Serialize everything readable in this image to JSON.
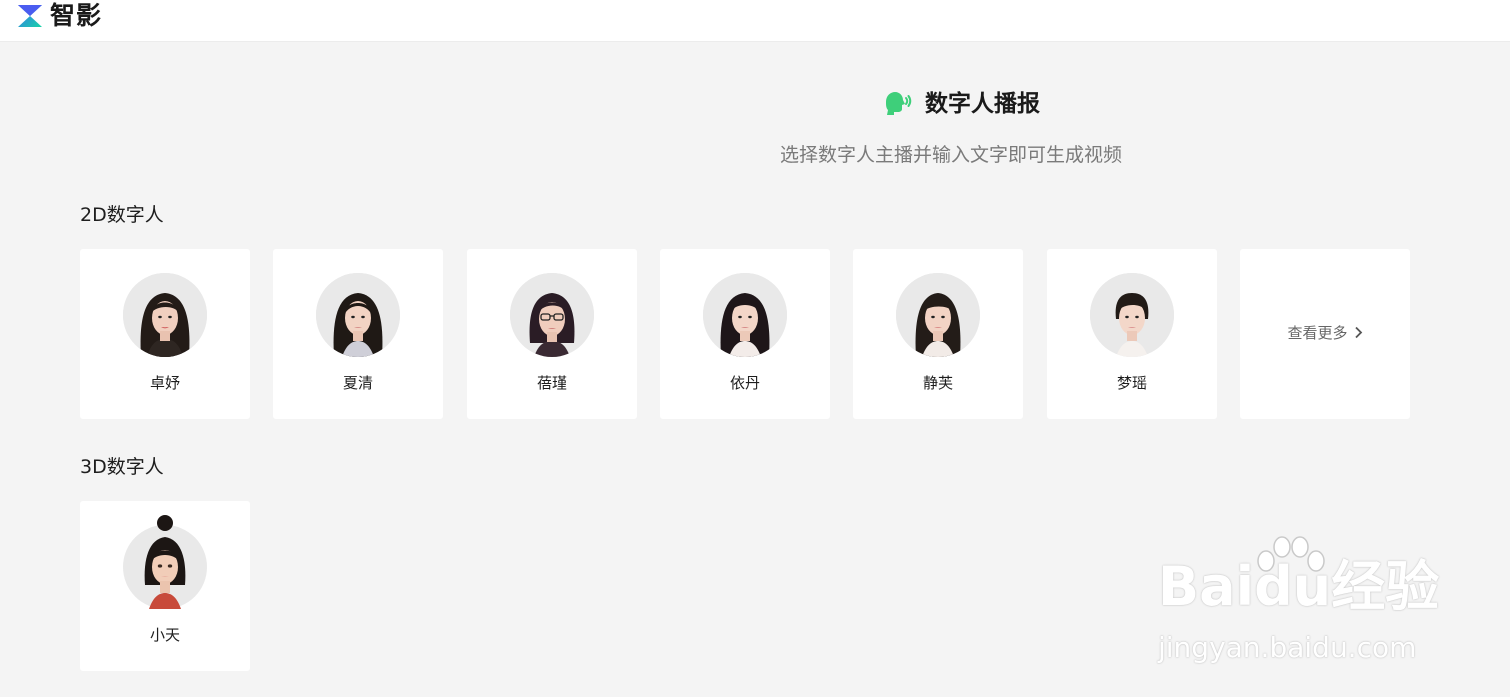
{
  "app": {
    "logo_text": "智影",
    "logo_icon": "z-logo-icon"
  },
  "hero": {
    "title": "数字人播报",
    "subtitle": "选择数字人主播并输入文字即可生成视频",
    "icon": "talking-head-icon"
  },
  "sections": {
    "two_d": {
      "title": "2D数字人",
      "items": [
        {
          "name": "卓妤"
        },
        {
          "name": "夏清"
        },
        {
          "name": "蓓瑾"
        },
        {
          "name": "依丹"
        },
        {
          "name": "静芙"
        },
        {
          "name": "梦瑶"
        }
      ],
      "more_label": "查看更多"
    },
    "three_d": {
      "title": "3D数字人",
      "items": [
        {
          "name": "小天"
        }
      ]
    }
  },
  "watermark": {
    "brand": "Baidu经验",
    "url": "jingyan.baidu.com"
  },
  "colors": {
    "background": "#f4f4f4",
    "card": "#ffffff",
    "accent_green": "#3ecf7a",
    "logo_blue": "#3a6cf5",
    "logo_teal": "#17d4a6"
  }
}
